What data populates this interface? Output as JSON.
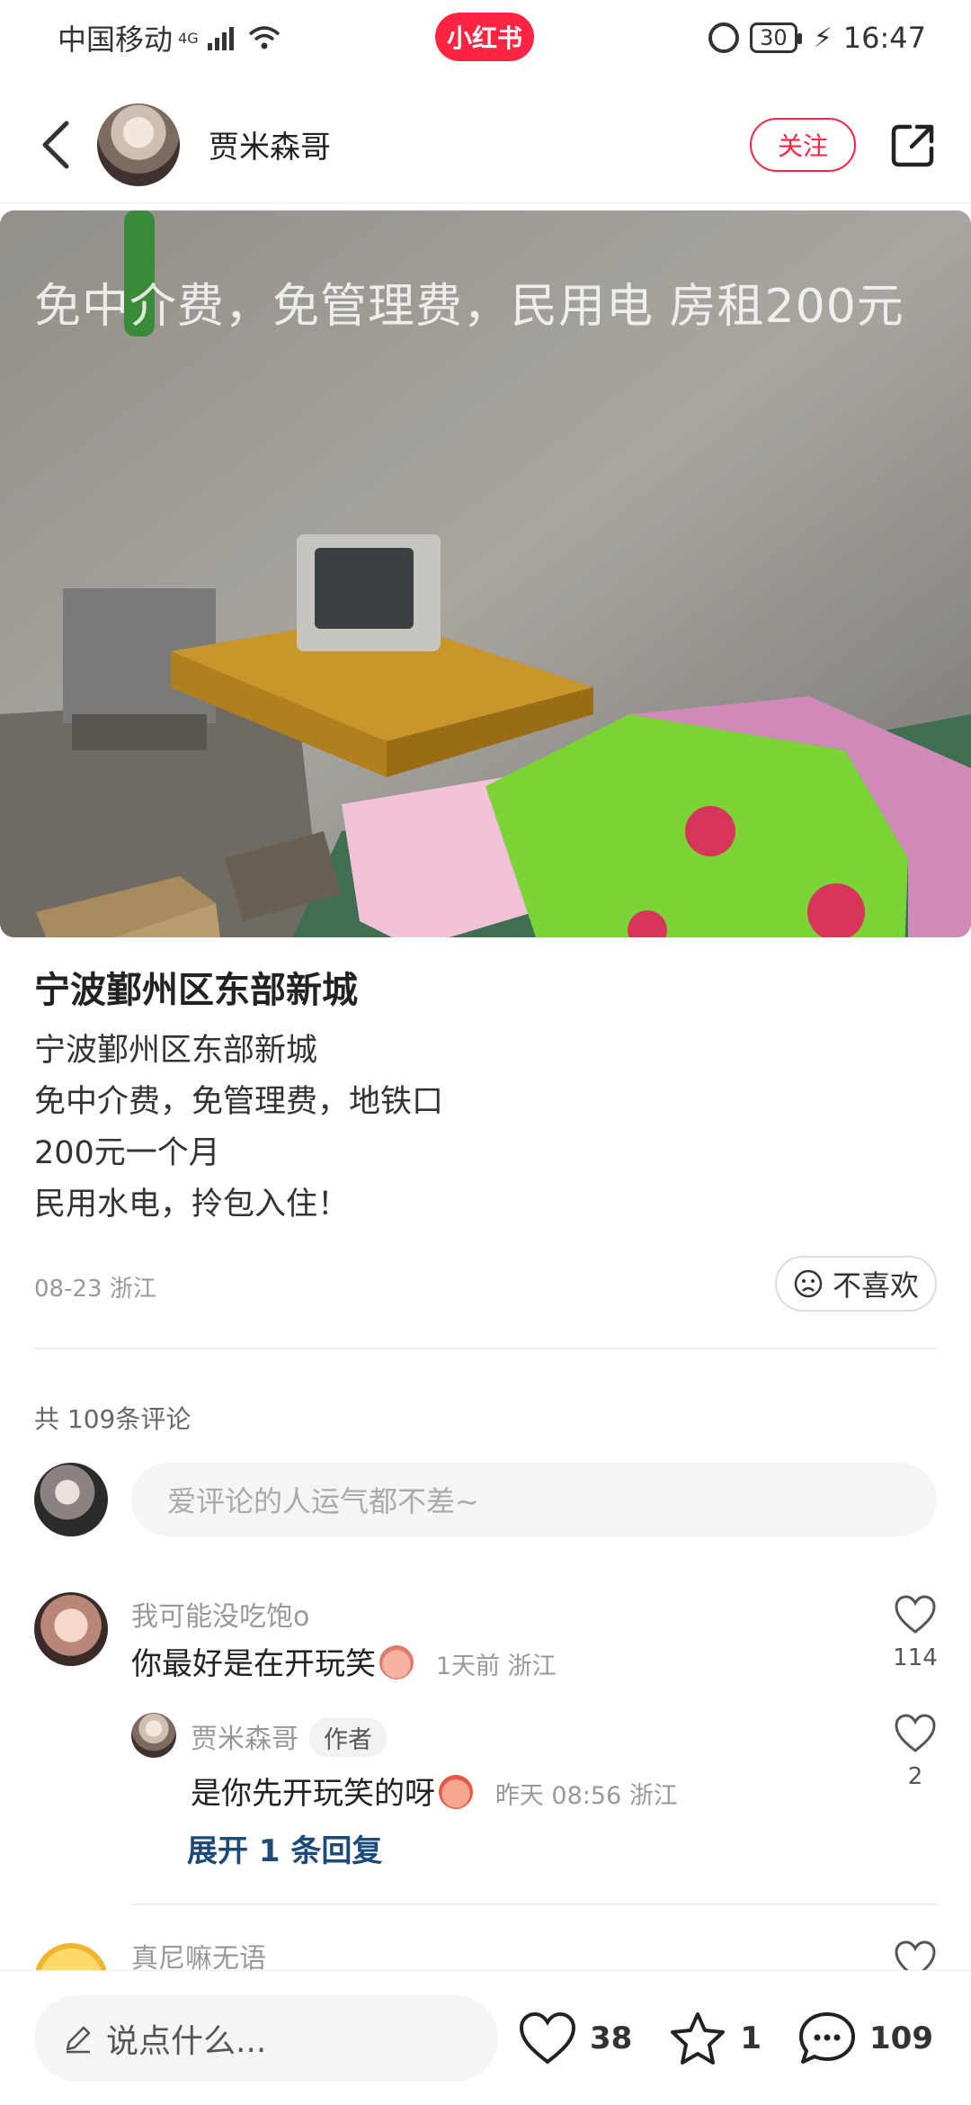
{
  "status_bar": {
    "carrier": "中国移动",
    "network": "4G",
    "app_badge": "小红书",
    "battery": "30",
    "time": "16:47"
  },
  "header": {
    "author": "贾米森哥",
    "follow_label": "关注"
  },
  "image": {
    "overlay_text": "免中介费，免管理费，民用电 房租200元"
  },
  "post": {
    "title": "宁波鄞州区东部新城",
    "lines": [
      "宁波鄞州区东部新城",
      "免中介费，免管理费，地铁口",
      "200元一个月",
      "民用水电，拎包入住！"
    ],
    "date": "08-23",
    "location": "浙江",
    "dislike_label": "不喜欢"
  },
  "comments": {
    "count_label": "共 109条评论",
    "input_placeholder": "爱评论的人运气都不差~",
    "items": [
      {
        "name": "我可能没吃饱o",
        "text": "你最好是在开玩笑",
        "time": "1天前",
        "location": "浙江",
        "likes": "114"
      }
    ],
    "reply": {
      "name": "贾米森哥",
      "tag": "作者",
      "text": "是你先开玩笑的呀",
      "time": "昨天 08:56",
      "location": "浙江",
      "likes": "2"
    },
    "expand_label": "展开 1 条回复",
    "partial": {
      "name": "真尼嘛无语"
    }
  },
  "bottom_bar": {
    "say_placeholder": "说点什么...",
    "like_count": "38",
    "star_count": "1",
    "comment_count": "109"
  },
  "colors": {
    "brand": "#ff2442",
    "link": "#1e4a7a"
  }
}
